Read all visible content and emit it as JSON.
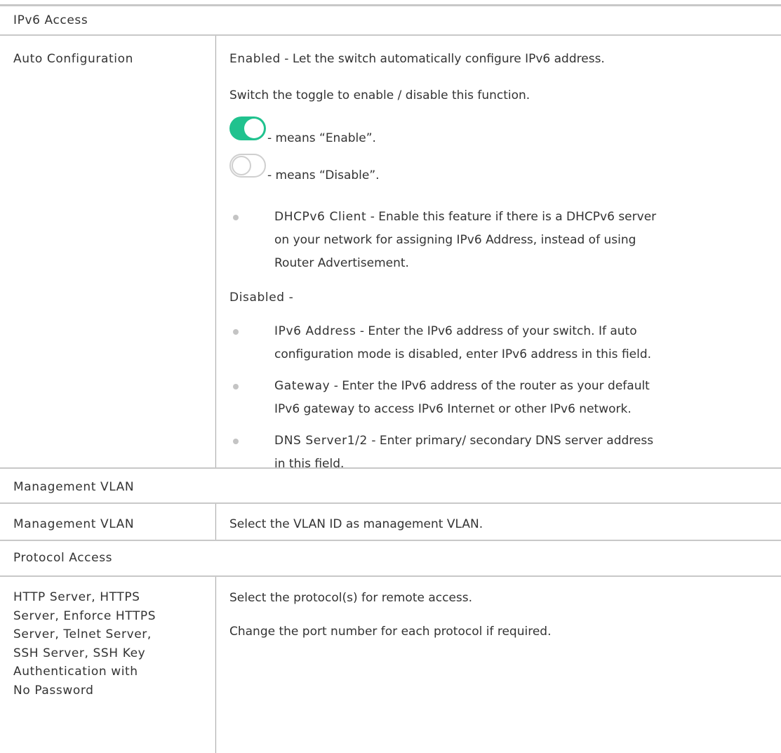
{
  "sections": [
    {
      "title": "IPv6 Access"
    },
    {
      "title": "Management VLAN"
    },
    {
      "title": "Protocol Access"
    }
  ],
  "auto_config": {
    "label": "Auto Configuration",
    "enabled_heading": "Enabled",
    "enabled_desc": " - Let the switch automatically configure IPv6 address.",
    "toggle_instruction": "Switch the toggle to enable / disable this function.",
    "toggle_on_caption": "- means “Enable”.",
    "toggle_off_caption": "- means “Disable”.",
    "dhcp_bullet": {
      "term": "DHCPv6 Client",
      "lines": [
        " - Enable this feature if there is a DHCPv6 server",
        "on your network for assigning IPv6 Address, instead of using",
        "Router Advertisement."
      ]
    },
    "disabled_heading": "Disabled -",
    "disabled_bullets": [
      {
        "term": "IPv6 Address",
        "lines": [
          " - Enter the IPv6 address of your switch. If auto",
          "configuration mode is disabled, enter IPv6 address in this field."
        ]
      },
      {
        "term": "Gateway",
        "lines": [
          " - Enter the IPv6 address of the router as your default",
          "IPv6 gateway to access IPv6 Internet or other IPv6 network."
        ]
      },
      {
        "term": "DNS Server1/2",
        "lines": [
          " - Enter primary/ secondary DNS server address",
          "in this field."
        ]
      }
    ]
  },
  "management_vlan": {
    "label": "Management VLAN",
    "desc": "Select the VLAN ID as management VLAN."
  },
  "protocol_access": {
    "label_lines": [
      "HTTP Server, HTTPS",
      "Server, Enforce HTTPS",
      "Server, Telnet Server,",
      "SSH Server, SSH Key",
      "Authentication with",
      "No Password"
    ],
    "desc1": "Select the protocol(s) for remote access.",
    "desc2": "Change the port number for each protocol if required."
  },
  "colors": {
    "toggle_on": "#20c28e",
    "border": "#c8c8c8",
    "text": "#333333"
  }
}
